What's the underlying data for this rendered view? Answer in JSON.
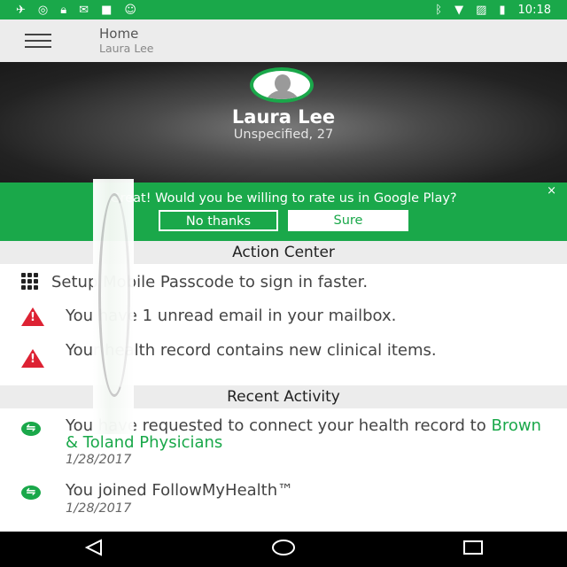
{
  "status_bar": {
    "time": "10:18",
    "left_icons": [
      "signal-icon",
      "cast-icon",
      "lock-icon",
      "mail-icon",
      "briefcase-icon",
      "android-icon"
    ],
    "right_icons": [
      "bluetooth-icon",
      "wifi-icon",
      "no-sim-icon",
      "battery-icon"
    ]
  },
  "appbar": {
    "title": "Home",
    "subtitle": "Laura Lee"
  },
  "profile": {
    "name": "Laura Lee",
    "details": "Unspecified, 27"
  },
  "rate_banner": {
    "text": "Great! Would you be willing to rate us in Google Play?",
    "no_label": "No thanks",
    "sure_label": "Sure",
    "close": "×"
  },
  "action_center": {
    "title": "Action Center",
    "items": [
      {
        "icon": "keypad-icon",
        "text": "Setup Mobile Passcode to sign in faster."
      },
      {
        "icon": "warning-icon",
        "text": "You have 1 unread email in your mailbox."
      },
      {
        "icon": "warning-icon",
        "text": "Your health record contains new clinical items."
      }
    ]
  },
  "recent_activity": {
    "title": "Recent Activity",
    "items": [
      {
        "icon": "connect-icon",
        "text": "You have requested to connect your health record to ",
        "link": "Brown & Toland Physicians",
        "date": "1/28/2017"
      },
      {
        "icon": "connect-icon",
        "text": "You joined FollowMyHealth™",
        "date": "1/28/2017"
      }
    ]
  },
  "colors": {
    "brand_green": "#1aa84a",
    "warning_red": "#dd2233"
  }
}
